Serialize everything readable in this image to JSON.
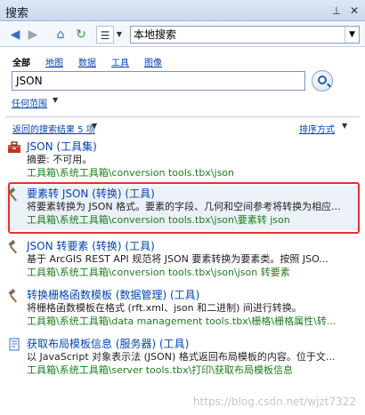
{
  "window": {
    "title": "搜索"
  },
  "toolbar": {
    "scope_value": "本地搜索"
  },
  "filters": [
    "全部",
    "地图",
    "数据",
    "工具",
    "图像"
  ],
  "search": {
    "query": "JSON"
  },
  "search_scope_label": "任何范围",
  "results_header": "返回的搜索结果 5 项",
  "sort_label": "排序方式",
  "results": [
    {
      "title": "JSON (工具集)",
      "desc": "摘要: 不可用。",
      "path": "工具箱\\系统工具箱\\conversion tools.tbx\\json"
    },
    {
      "title": "要素转 JSON (转换) (工具)",
      "desc": "将要素转换为 JSON 格式。要素的字段、几何和空间参考将转换为相应...",
      "path": "工具箱\\系统工具箱\\conversion tools.tbx\\json\\要素转 json"
    },
    {
      "title": "JSON 转要素 (转换) (工具)",
      "desc": "基于 ArcGIS REST API 规范将 JSON 要素转换为要素类。按照 JSO...",
      "path": "工具箱\\系统工具箱\\conversion tools.tbx\\json\\json 转要素"
    },
    {
      "title": "转换栅格函数模板 (数据管理) (工具)",
      "desc": "将栅格函数模板在格式 (rft.xml、json 和二进制) 间进行转换。",
      "path": "工具箱\\系统工具箱\\data management tools.tbx\\栅格\\栅格属性\\转..."
    },
    {
      "title": "获取布局模板信息 (服务器) (工具)",
      "desc": "以 JavaScript 对象表示法 (JSON) 格式返回布局模板的内容。位于文...",
      "path": "工具箱\\系统工具箱\\server tools.tbx\\打印\\获取布局模板信息"
    }
  ],
  "watermark": "https://blog.csdn.net/wjzt7322"
}
